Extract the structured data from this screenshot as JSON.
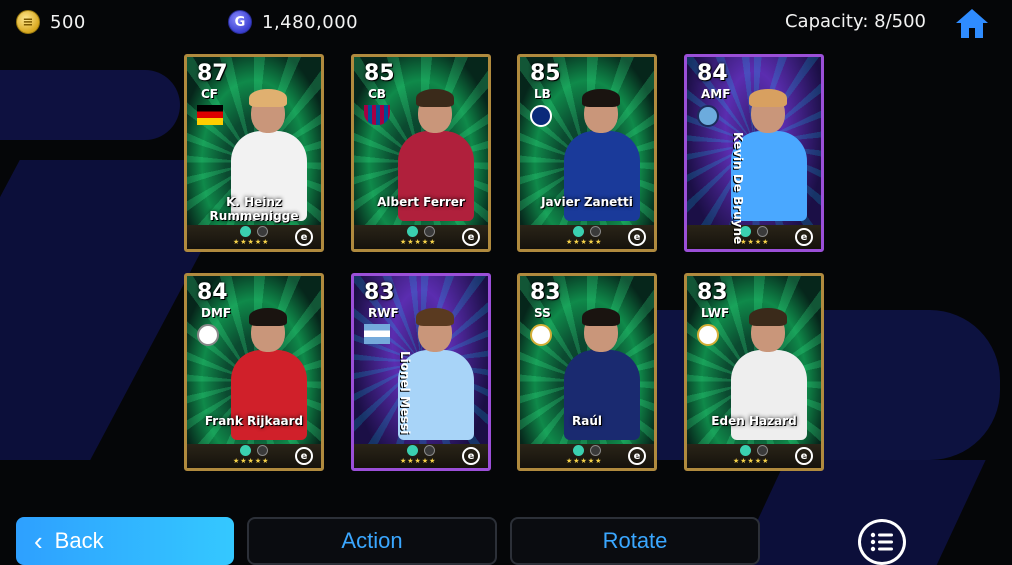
{
  "topbar": {
    "ecoin_icon": "e-coin-icon",
    "ecoin_value": "500",
    "gp_icon": "gp-coin-icon",
    "gp_value": "1,480,000",
    "capacity": "Capacity: 8/500",
    "home_icon": "home-icon"
  },
  "cards": [
    {
      "rating": "87",
      "position": "CF",
      "name": "K. Heinz Rummenigge",
      "style": "green",
      "badge": "germany-flag",
      "hair": "#e0b070",
      "kit": "#f2f2f2"
    },
    {
      "rating": "85",
      "position": "CB",
      "name": "Albert Ferrer",
      "style": "green",
      "badge": "barcelona-crest",
      "hair": "#3a2a1a",
      "kit": "#b0203c"
    },
    {
      "rating": "85",
      "position": "LB",
      "name": "Javier Zanetti",
      "style": "green",
      "badge": "inter-crest",
      "hair": "#1a1410",
      "kit": "#1a3a9a"
    },
    {
      "rating": "84",
      "position": "AMF",
      "name": "Kevin De Bruyne",
      "style": "purple",
      "badge": "city-crest",
      "hair": "#d8a060",
      "kit": "#4aa8ff"
    },
    {
      "rating": "84",
      "position": "DMF",
      "name": "Frank Rijkaard",
      "style": "green",
      "badge": "ajax-crest",
      "hair": "#1a1410",
      "kit": "#d0202a"
    },
    {
      "rating": "83",
      "position": "RWF",
      "name": "Lionel Messi",
      "style": "purple",
      "badge": "argentina-flag",
      "hair": "#5a3a20",
      "kit": "#a8d4f8"
    },
    {
      "rating": "83",
      "position": "SS",
      "name": "Raúl",
      "style": "green",
      "badge": "madrid-crest",
      "hair": "#1a1410",
      "kit": "#1a2a70"
    },
    {
      "rating": "83",
      "position": "LWF",
      "name": "Eden Hazard",
      "style": "green",
      "badge": "madrid-crest",
      "hair": "#3a2a1a",
      "kit": "#eeeeee"
    }
  ],
  "buttons": {
    "back": "Back",
    "action": "Action",
    "rotate": "Rotate",
    "menu_icon": "list-menu-icon"
  }
}
